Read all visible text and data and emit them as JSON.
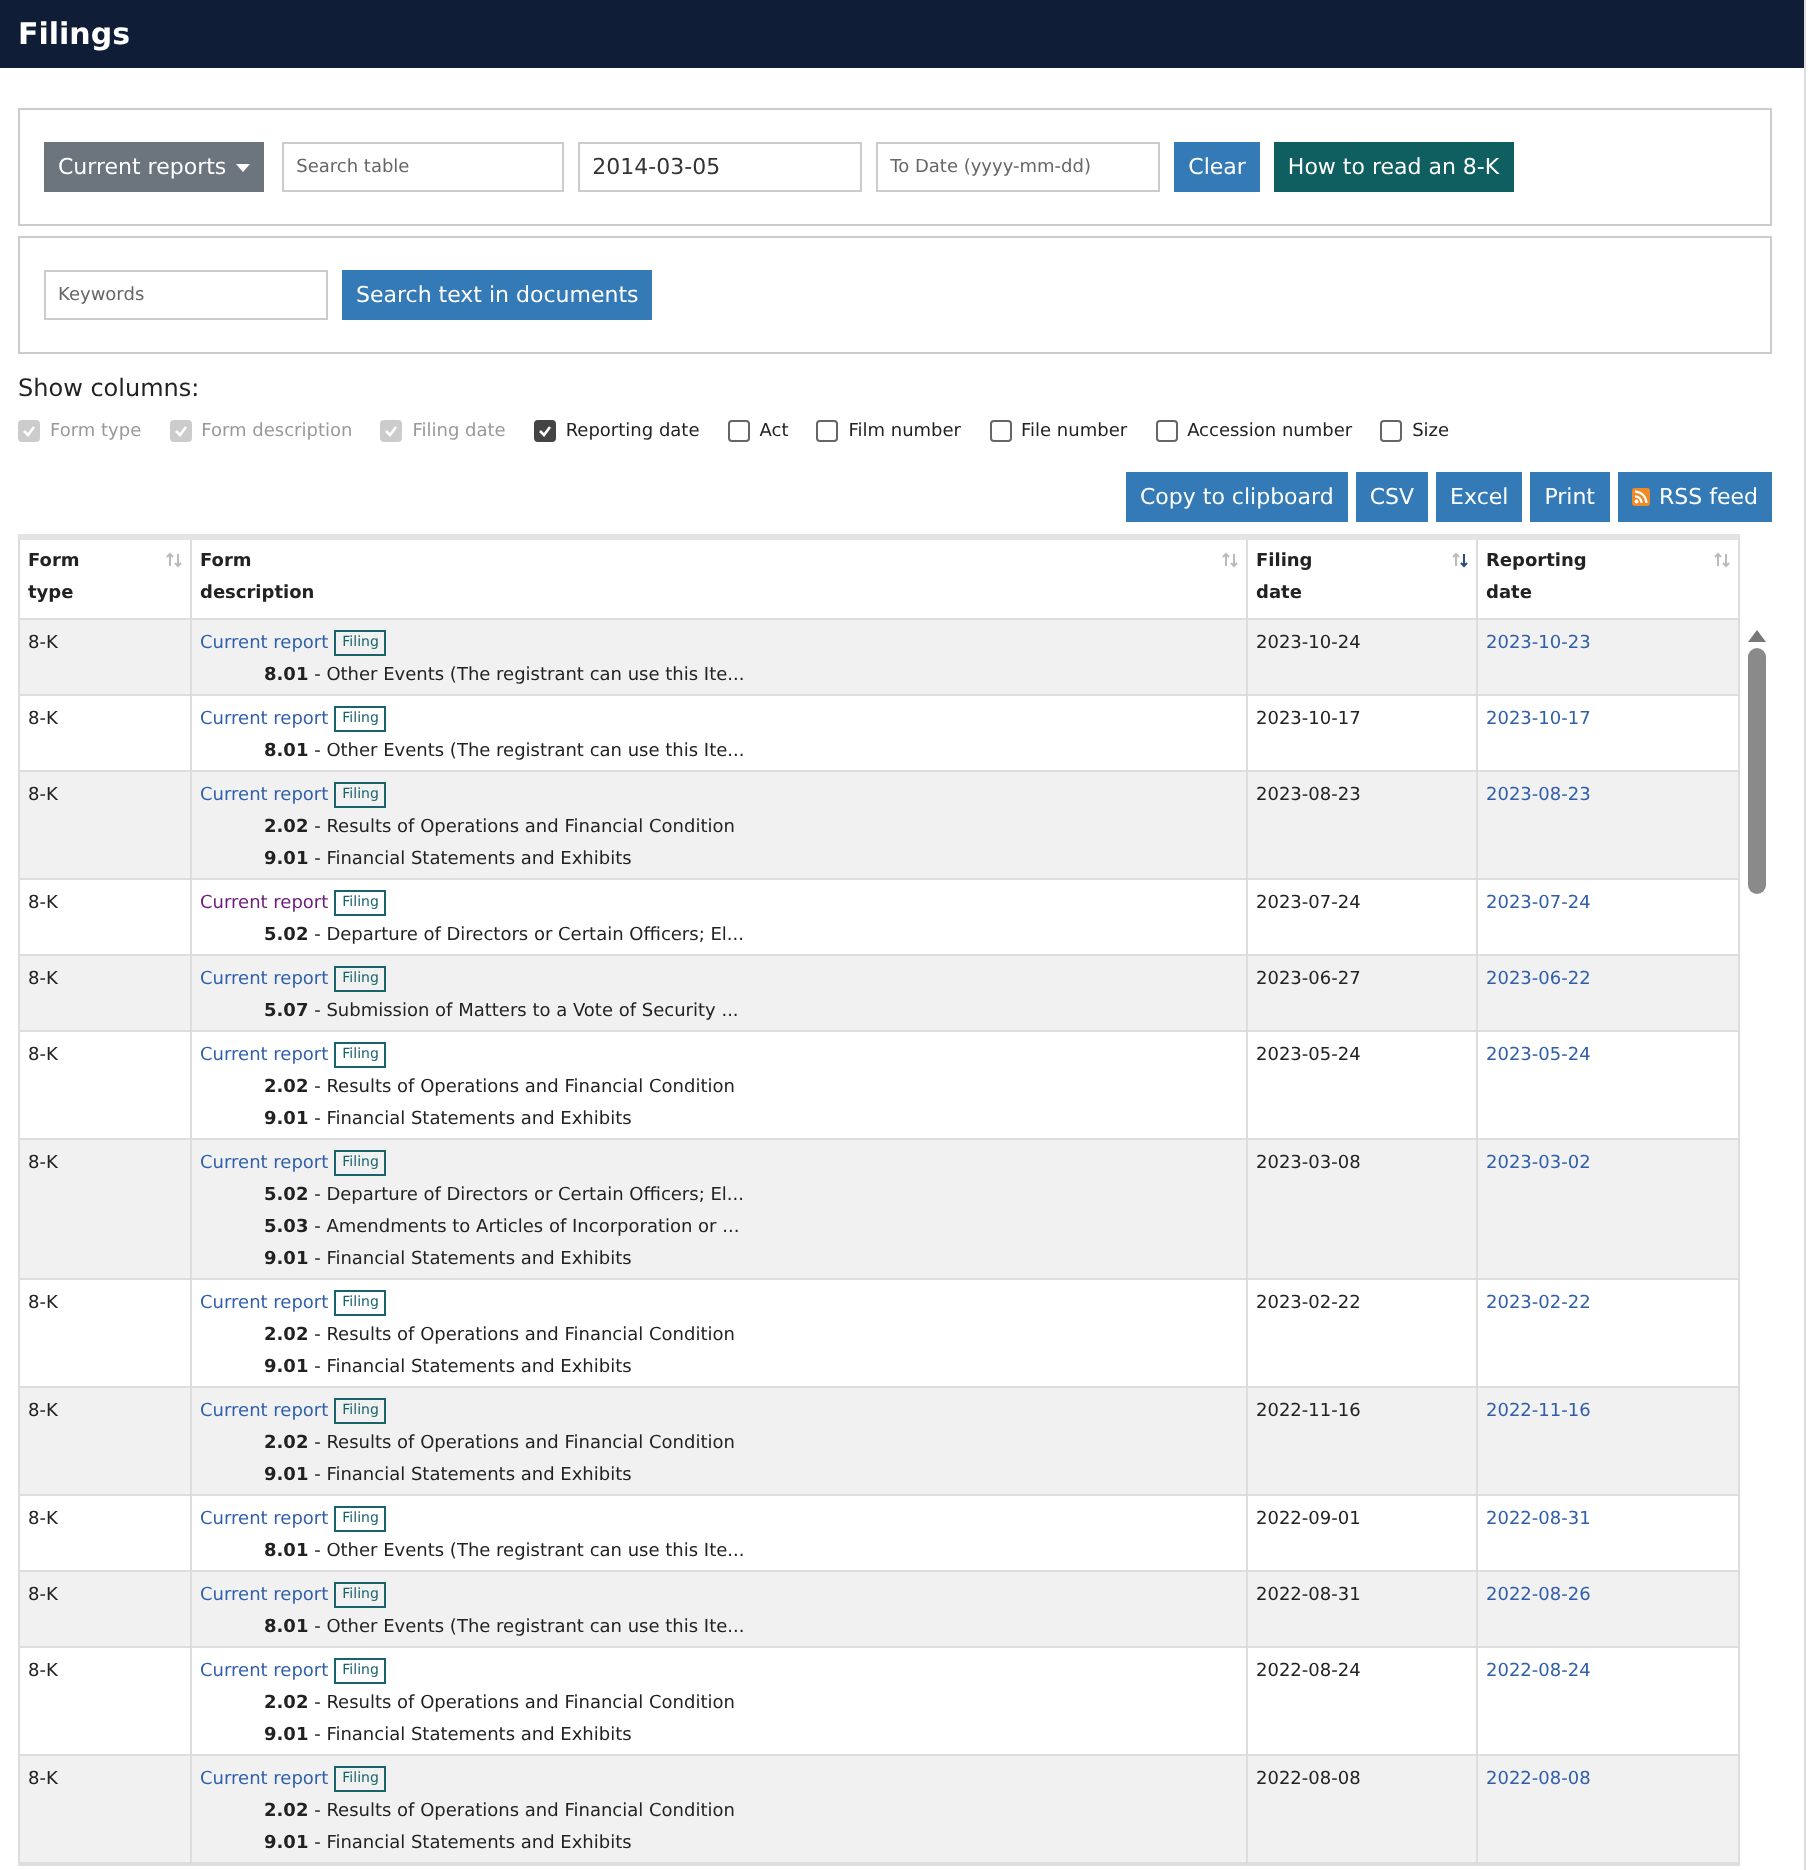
{
  "header": {
    "title": "Filings"
  },
  "filters": {
    "report_menu": "Current reports",
    "search": {
      "placeholder": "Search table"
    },
    "from_date": {
      "value": "2014-03-05"
    },
    "to_date": {
      "placeholder": "To Date (yyyy-mm-dd)"
    },
    "clear": "Clear",
    "help": "How to read an 8-K"
  },
  "keywords": {
    "placeholder": "Keywords",
    "button": "Search text in documents"
  },
  "show_columns": {
    "label": "Show columns:",
    "options": [
      {
        "label": "Form type",
        "checked": true,
        "disabled": true
      },
      {
        "label": "Form description",
        "checked": true,
        "disabled": true
      },
      {
        "label": "Filing date",
        "checked": true,
        "disabled": true
      },
      {
        "label": "Reporting date",
        "checked": true,
        "disabled": false
      },
      {
        "label": "Act",
        "checked": false,
        "disabled": false
      },
      {
        "label": "Film number",
        "checked": false,
        "disabled": false
      },
      {
        "label": "File number",
        "checked": false,
        "disabled": false
      },
      {
        "label": "Accession number",
        "checked": false,
        "disabled": false
      },
      {
        "label": "Size",
        "checked": false,
        "disabled": false
      }
    ]
  },
  "export_buttons": [
    {
      "label": "Copy to clipboard",
      "kind": "plain"
    },
    {
      "label": "CSV",
      "kind": "plain"
    },
    {
      "label": "Excel",
      "kind": "plain"
    },
    {
      "label": "Print",
      "kind": "plain"
    },
    {
      "label": "RSS feed",
      "kind": "rss"
    }
  ],
  "table": {
    "columns": [
      {
        "line1": "Form",
        "line2": "type",
        "sorted_desc": false
      },
      {
        "line1": "Form",
        "line2": "description",
        "sorted_desc": false
      },
      {
        "line1": "Filing",
        "line2": "date",
        "sorted_desc": true
      },
      {
        "line1": "Reporting",
        "line2": "date",
        "sorted_desc": false
      }
    ],
    "rows": [
      {
        "form_type": "8-K",
        "link": "Current report",
        "visited": false,
        "tag": "Filing",
        "items": [
          "**8.01** - Other Events (The registrant can use this Ite..."
        ],
        "filing_date": "2023-10-24",
        "reporting_date": "2023-10-23"
      },
      {
        "form_type": "8-K",
        "link": "Current report",
        "visited": false,
        "tag": "Filing",
        "items": [
          "**8.01** - Other Events (The registrant can use this Ite..."
        ],
        "filing_date": "2023-10-17",
        "reporting_date": "2023-10-17"
      },
      {
        "form_type": "8-K",
        "link": "Current report",
        "visited": false,
        "tag": "Filing",
        "items": [
          "**2.02** - Results of Operations and Financial Condition",
          "**9.01** - Financial Statements and Exhibits"
        ],
        "filing_date": "2023-08-23",
        "reporting_date": "2023-08-23"
      },
      {
        "form_type": "8-K",
        "link": "Current report",
        "visited": true,
        "tag": "Filing",
        "items": [
          "**5.02** - Departure of Directors or Certain Officers; El..."
        ],
        "filing_date": "2023-07-24",
        "reporting_date": "2023-07-24"
      },
      {
        "form_type": "8-K",
        "link": "Current report",
        "visited": false,
        "tag": "Filing",
        "items": [
          "**5.07** - Submission of Matters to a Vote of Security ..."
        ],
        "filing_date": "2023-06-27",
        "reporting_date": "2023-06-22"
      },
      {
        "form_type": "8-K",
        "link": "Current report",
        "visited": false,
        "tag": "Filing",
        "items": [
          "**2.02** - Results of Operations and Financial Condition",
          "**9.01** - Financial Statements and Exhibits"
        ],
        "filing_date": "2023-05-24",
        "reporting_date": "2023-05-24"
      },
      {
        "form_type": "8-K",
        "link": "Current report",
        "visited": false,
        "tag": "Filing",
        "items": [
          "**5.02** - Departure of Directors or Certain Officers; El...",
          "**5.03** - Amendments to Articles of Incorporation or ...",
          "**9.01** - Financial Statements and Exhibits"
        ],
        "filing_date": "2023-03-08",
        "reporting_date": "2023-03-02"
      },
      {
        "form_type": "8-K",
        "link": "Current report",
        "visited": false,
        "tag": "Filing",
        "items": [
          "**2.02** - Results of Operations and Financial Condition",
          "**9.01** - Financial Statements and Exhibits"
        ],
        "filing_date": "2023-02-22",
        "reporting_date": "2023-02-22"
      },
      {
        "form_type": "8-K",
        "link": "Current report",
        "visited": false,
        "tag": "Filing",
        "items": [
          "**2.02** - Results of Operations and Financial Condition",
          "**9.01** - Financial Statements and Exhibits"
        ],
        "filing_date": "2022-11-16",
        "reporting_date": "2022-11-16"
      },
      {
        "form_type": "8-K",
        "link": "Current report",
        "visited": false,
        "tag": "Filing",
        "items": [
          "**8.01** - Other Events (The registrant can use this Ite..."
        ],
        "filing_date": "2022-09-01",
        "reporting_date": "2022-08-31"
      },
      {
        "form_type": "8-K",
        "link": "Current report",
        "visited": false,
        "tag": "Filing",
        "items": [
          "**8.01** - Other Events (The registrant can use this Ite..."
        ],
        "filing_date": "2022-08-31",
        "reporting_date": "2022-08-26"
      },
      {
        "form_type": "8-K",
        "link": "Current report",
        "visited": false,
        "tag": "Filing",
        "items": [
          "**2.02** - Results of Operations and Financial Condition",
          "**9.01** - Financial Statements and Exhibits"
        ],
        "filing_date": "2022-08-24",
        "reporting_date": "2022-08-24"
      },
      {
        "form_type": "8-K",
        "link": "Current report",
        "visited": false,
        "tag": "Filing",
        "items": [
          "**2.02** - Results of Operations and Financial Condition",
          "**9.01** - Financial Statements and Exhibits"
        ],
        "filing_date": "2022-08-08",
        "reporting_date": "2022-08-08"
      }
    ]
  }
}
